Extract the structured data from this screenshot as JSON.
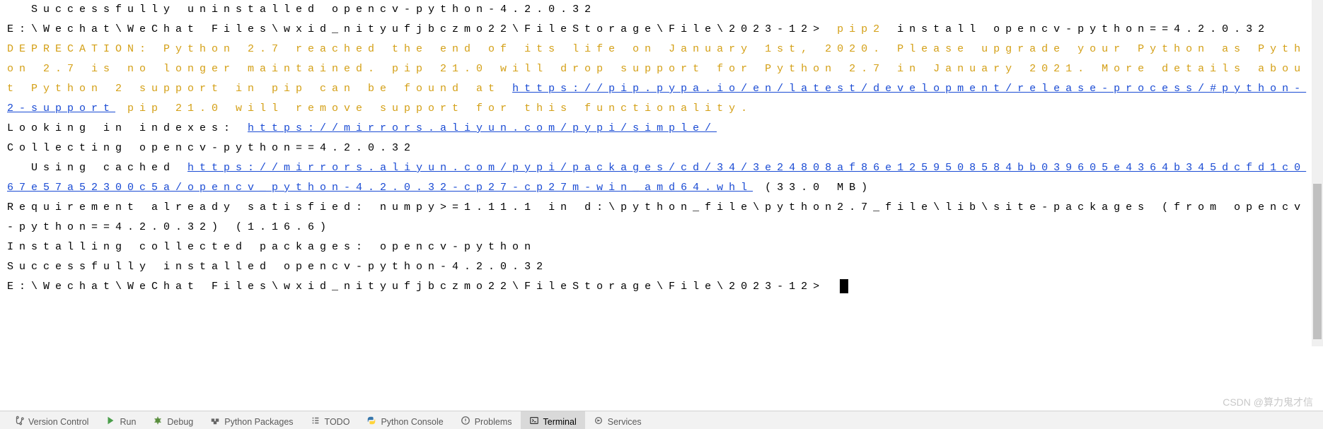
{
  "terminal": {
    "line0": "  Successfully uninstalled opencv-python-4.2.0.32",
    "prompt1_path": "E:\\Wechat\\WeChat Files\\wxid_nityufjbczmo22\\FileStorage\\File\\2023-12> ",
    "prompt1_cmd": "pip2",
    "prompt1_rest": " install opencv-python==4.2.0.32",
    "deprecation_pre": "DEPRECATION: Python 2.7 reached the end of its life on January 1st, 2020. Please upgrade your Python as Python 2.7 is no longer maintained. pip 21.0 will drop support for Python 2.7 in January 2021. More details about Python 2 support in pip can be found at ",
    "deprecation_link": "https://pip.pypa.io/en/latest/development/release-process/#python-2-support",
    "deprecation_post": " pip 21.0 will remove support for this functionality.",
    "indexes_label": "Looking in indexes: ",
    "indexes_link": "https://mirrors.aliyun.com/pypi/simple/",
    "collecting": "Collecting opencv-python==4.2.0.32",
    "using_cached_label": "  Using cached ",
    "using_cached_link": "https://mirrors.aliyun.com/pypi/packages/cd/34/3e24808af86e1259508584bb039605e4364b345dcfd1c067e57a52300c5a/opencv_python-4.2.0.32-cp27-cp27m-win_amd64.whl",
    "using_cached_size": " (33.0 MB)",
    "requirement": "Requirement already satisfied: numpy>=1.11.1 in d:\\python_file\\python2.7_file\\lib\\site-packages (from opencv-python==4.2.0.32) (1.16.6)",
    "installing": "Installing collected packages: opencv-python",
    "success": "Successfully installed opencv-python-4.2.0.32",
    "prompt2": "E:\\Wechat\\WeChat Files\\wxid_nityufjbczmo22\\FileStorage\\File\\2023-12> "
  },
  "watermark": "CSDN @算力鬼才信",
  "toolbar": {
    "version_control": "Version Control",
    "run": "Run",
    "debug": "Debug",
    "python_packages": "Python Packages",
    "todo": "TODO",
    "python_console": "Python Console",
    "problems": "Problems",
    "terminal": "Terminal",
    "services": "Services"
  }
}
